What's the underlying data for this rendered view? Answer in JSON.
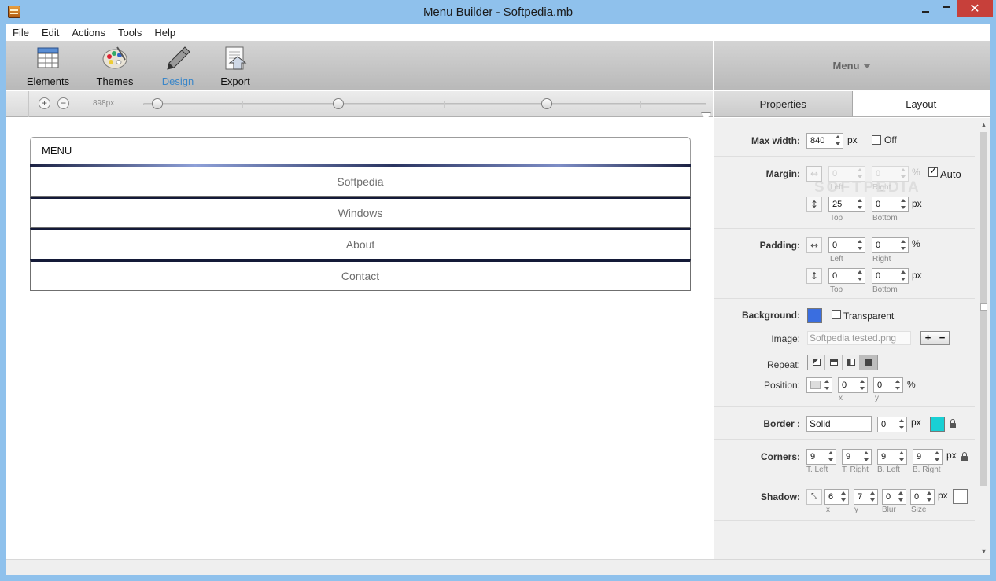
{
  "window": {
    "title": "Menu Builder - Softpedia.mb"
  },
  "menubar": [
    "File",
    "Edit",
    "Actions",
    "Tools",
    "Help"
  ],
  "toolbar": {
    "elements": "Elements",
    "themes": "Themes",
    "design": "Design",
    "export": "Export"
  },
  "zoom": {
    "width_label": "898px"
  },
  "right_header": {
    "selector": "Menu"
  },
  "tabs": {
    "properties": "Properties",
    "layout": "Layout"
  },
  "preview": {
    "header": "MENU",
    "items": [
      "Softpedia",
      "Windows",
      "About",
      "Contact"
    ]
  },
  "props": {
    "max_width": {
      "label": "Max width:",
      "value": "840",
      "unit": "px",
      "off_label": "Off",
      "off_checked": false
    },
    "margin": {
      "label": "Margin:",
      "left": "0",
      "right": "0",
      "unit_h": "%",
      "auto_label": "Auto",
      "auto_checked": true,
      "top": "25",
      "bottom": "0",
      "unit_v": "px",
      "sub_left": "Left",
      "sub_right": "Right",
      "sub_top": "Top",
      "sub_bottom": "Bottom"
    },
    "padding": {
      "label": "Padding:",
      "left": "0",
      "right": "0",
      "unit_h": "%",
      "top": "0",
      "bottom": "0",
      "unit_v": "px",
      "sub_left": "Left",
      "sub_right": "Right",
      "sub_top": "Top",
      "sub_bottom": "Bottom"
    },
    "background": {
      "label": "Background:",
      "color": "#3a6ee0",
      "transparent_label": "Transparent",
      "transparent_checked": false,
      "image_label": "Image:",
      "image_value": "Softpedia tested.png",
      "repeat_label": "Repeat:",
      "position_label": "Position:",
      "pos_x": "0",
      "pos_y": "0",
      "pos_unit": "%",
      "sub_x": "x",
      "sub_y": "y"
    },
    "border": {
      "label": "Border :",
      "style": "Solid",
      "width": "0",
      "unit": "px",
      "color": "#19d0d4"
    },
    "corners": {
      "label": "Corners:",
      "tl": "9",
      "tr": "9",
      "bl": "9",
      "br": "9",
      "unit": "px",
      "sub_tl": "T. Left",
      "sub_tr": "T. Right",
      "sub_bl": "B. Left",
      "sub_br": "B. Right"
    },
    "shadow": {
      "label": "Shadow:",
      "x": "6",
      "y": "7",
      "blur": "0",
      "size": "0",
      "unit": "px",
      "color": "#ffffff",
      "sub_x": "x",
      "sub_y": "y",
      "sub_blur": "Blur",
      "sub_size": "Size"
    }
  },
  "watermark": "SOFTPEDIA"
}
